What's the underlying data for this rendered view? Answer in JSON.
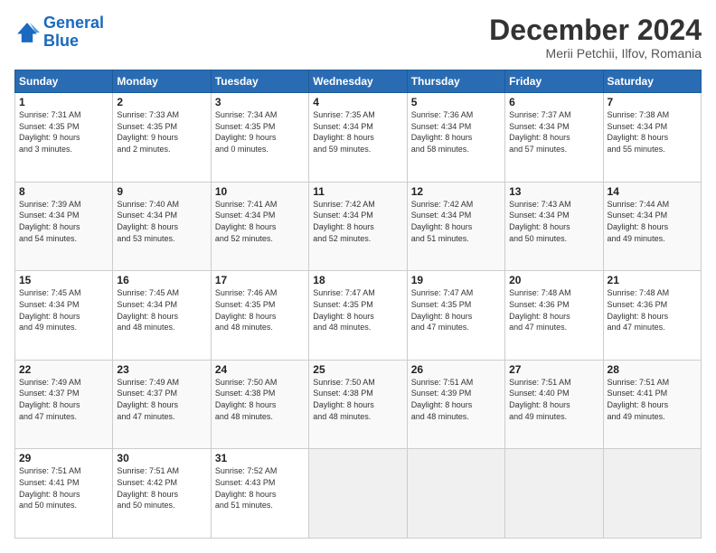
{
  "header": {
    "logo_line1": "General",
    "logo_line2": "Blue",
    "title": "December 2024",
    "subtitle": "Merii Petchii, Ilfov, Romania"
  },
  "calendar": {
    "weekdays": [
      "Sunday",
      "Monday",
      "Tuesday",
      "Wednesday",
      "Thursday",
      "Friday",
      "Saturday"
    ],
    "rows": [
      [
        {
          "day": "1",
          "info": "Sunrise: 7:31 AM\nSunset: 4:35 PM\nDaylight: 9 hours\nand 3 minutes."
        },
        {
          "day": "2",
          "info": "Sunrise: 7:33 AM\nSunset: 4:35 PM\nDaylight: 9 hours\nand 2 minutes."
        },
        {
          "day": "3",
          "info": "Sunrise: 7:34 AM\nSunset: 4:35 PM\nDaylight: 9 hours\nand 0 minutes."
        },
        {
          "day": "4",
          "info": "Sunrise: 7:35 AM\nSunset: 4:34 PM\nDaylight: 8 hours\nand 59 minutes."
        },
        {
          "day": "5",
          "info": "Sunrise: 7:36 AM\nSunset: 4:34 PM\nDaylight: 8 hours\nand 58 minutes."
        },
        {
          "day": "6",
          "info": "Sunrise: 7:37 AM\nSunset: 4:34 PM\nDaylight: 8 hours\nand 57 minutes."
        },
        {
          "day": "7",
          "info": "Sunrise: 7:38 AM\nSunset: 4:34 PM\nDaylight: 8 hours\nand 55 minutes."
        }
      ],
      [
        {
          "day": "8",
          "info": "Sunrise: 7:39 AM\nSunset: 4:34 PM\nDaylight: 8 hours\nand 54 minutes."
        },
        {
          "day": "9",
          "info": "Sunrise: 7:40 AM\nSunset: 4:34 PM\nDaylight: 8 hours\nand 53 minutes."
        },
        {
          "day": "10",
          "info": "Sunrise: 7:41 AM\nSunset: 4:34 PM\nDaylight: 8 hours\nand 52 minutes."
        },
        {
          "day": "11",
          "info": "Sunrise: 7:42 AM\nSunset: 4:34 PM\nDaylight: 8 hours\nand 52 minutes."
        },
        {
          "day": "12",
          "info": "Sunrise: 7:42 AM\nSunset: 4:34 PM\nDaylight: 8 hours\nand 51 minutes."
        },
        {
          "day": "13",
          "info": "Sunrise: 7:43 AM\nSunset: 4:34 PM\nDaylight: 8 hours\nand 50 minutes."
        },
        {
          "day": "14",
          "info": "Sunrise: 7:44 AM\nSunset: 4:34 PM\nDaylight: 8 hours\nand 49 minutes."
        }
      ],
      [
        {
          "day": "15",
          "info": "Sunrise: 7:45 AM\nSunset: 4:34 PM\nDaylight: 8 hours\nand 49 minutes."
        },
        {
          "day": "16",
          "info": "Sunrise: 7:45 AM\nSunset: 4:34 PM\nDaylight: 8 hours\nand 48 minutes."
        },
        {
          "day": "17",
          "info": "Sunrise: 7:46 AM\nSunset: 4:35 PM\nDaylight: 8 hours\nand 48 minutes."
        },
        {
          "day": "18",
          "info": "Sunrise: 7:47 AM\nSunset: 4:35 PM\nDaylight: 8 hours\nand 48 minutes."
        },
        {
          "day": "19",
          "info": "Sunrise: 7:47 AM\nSunset: 4:35 PM\nDaylight: 8 hours\nand 47 minutes."
        },
        {
          "day": "20",
          "info": "Sunrise: 7:48 AM\nSunset: 4:36 PM\nDaylight: 8 hours\nand 47 minutes."
        },
        {
          "day": "21",
          "info": "Sunrise: 7:48 AM\nSunset: 4:36 PM\nDaylight: 8 hours\nand 47 minutes."
        }
      ],
      [
        {
          "day": "22",
          "info": "Sunrise: 7:49 AM\nSunset: 4:37 PM\nDaylight: 8 hours\nand 47 minutes."
        },
        {
          "day": "23",
          "info": "Sunrise: 7:49 AM\nSunset: 4:37 PM\nDaylight: 8 hours\nand 47 minutes."
        },
        {
          "day": "24",
          "info": "Sunrise: 7:50 AM\nSunset: 4:38 PM\nDaylight: 8 hours\nand 48 minutes."
        },
        {
          "day": "25",
          "info": "Sunrise: 7:50 AM\nSunset: 4:38 PM\nDaylight: 8 hours\nand 48 minutes."
        },
        {
          "day": "26",
          "info": "Sunrise: 7:51 AM\nSunset: 4:39 PM\nDaylight: 8 hours\nand 48 minutes."
        },
        {
          "day": "27",
          "info": "Sunrise: 7:51 AM\nSunset: 4:40 PM\nDaylight: 8 hours\nand 49 minutes."
        },
        {
          "day": "28",
          "info": "Sunrise: 7:51 AM\nSunset: 4:41 PM\nDaylight: 8 hours\nand 49 minutes."
        }
      ],
      [
        {
          "day": "29",
          "info": "Sunrise: 7:51 AM\nSunset: 4:41 PM\nDaylight: 8 hours\nand 50 minutes."
        },
        {
          "day": "30",
          "info": "Sunrise: 7:51 AM\nSunset: 4:42 PM\nDaylight: 8 hours\nand 50 minutes."
        },
        {
          "day": "31",
          "info": "Sunrise: 7:52 AM\nSunset: 4:43 PM\nDaylight: 8 hours\nand 51 minutes."
        },
        {
          "day": "",
          "info": ""
        },
        {
          "day": "",
          "info": ""
        },
        {
          "day": "",
          "info": ""
        },
        {
          "day": "",
          "info": ""
        }
      ]
    ]
  }
}
